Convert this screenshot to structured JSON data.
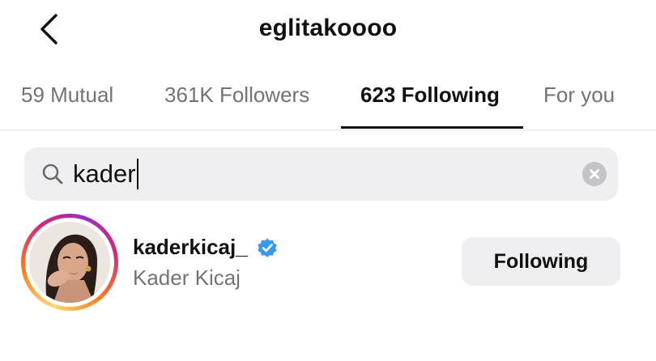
{
  "header": {
    "title": "eglitakoooo",
    "back_icon": "chevron-left-icon"
  },
  "tabs": [
    {
      "label": "59 Mutual",
      "active": false
    },
    {
      "label": "361K Followers",
      "active": false
    },
    {
      "label": "623 Following",
      "active": true
    },
    {
      "label": "For you",
      "active": false
    }
  ],
  "search": {
    "value": "kader",
    "icon": "search-icon",
    "clear_icon": "clear-icon"
  },
  "results": [
    {
      "username": "kaderkicaj_",
      "full_name": "Kader Kicaj",
      "verified": true,
      "button_label": "Following"
    }
  ],
  "colors": {
    "verified_blue": "#3897f0",
    "text_primary": "#111111",
    "text_secondary": "#737373",
    "input_bg": "#efeff1"
  }
}
